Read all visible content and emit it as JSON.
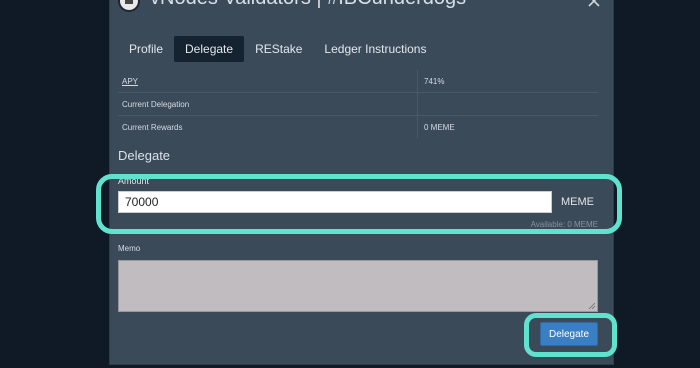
{
  "modal": {
    "title": "vNodes Validators | #IBCunderdogs",
    "logo_icon": "validator-logo-icon",
    "close_icon": "close-icon"
  },
  "tabs": [
    {
      "label": "Profile",
      "active": false
    },
    {
      "label": "Delegate",
      "active": true
    },
    {
      "label": "REStake",
      "active": false
    },
    {
      "label": "Ledger Instructions",
      "active": false
    }
  ],
  "info": {
    "apy_label": "APY",
    "apy_value": "741%",
    "current_delegation_label": "Current Delegation",
    "current_delegation_value": "",
    "current_rewards_label": "Current Rewards",
    "current_rewards_value": "0 MEME"
  },
  "delegate_form": {
    "section_title": "Delegate",
    "amount_label": "Amount",
    "amount_value": "70000",
    "unit": "MEME",
    "available": "Available: 0 MEME",
    "memo_label": "Memo",
    "memo_value": "",
    "submit_label": "Delegate"
  },
  "colors": {
    "background": "#0f1a26",
    "modal": "#3b4a59",
    "accent": "#3a7fc3",
    "highlight": "#5fe3cf"
  }
}
